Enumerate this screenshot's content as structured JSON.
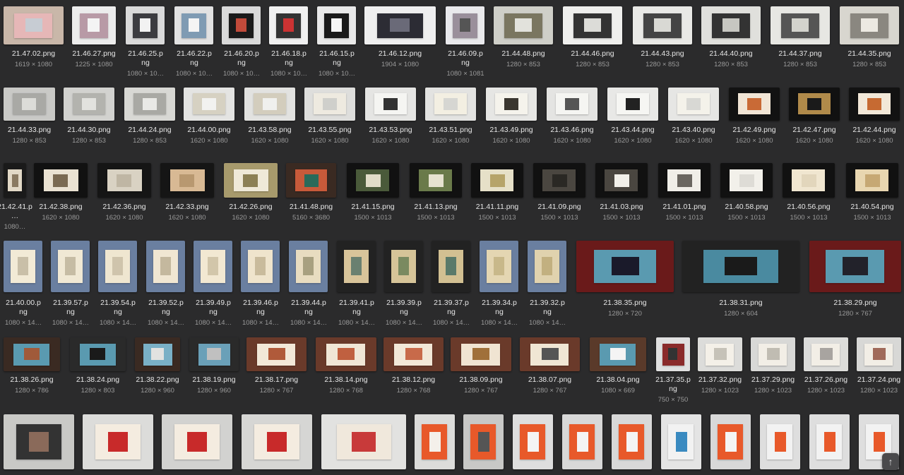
{
  "files": [
    {
      "name": "21.47.02.png",
      "dims": "1619 × 1080",
      "colors": [
        "#c9b7a9",
        "#e6b7b7",
        "#c7ccd3"
      ]
    },
    {
      "name": "21.46.27.png",
      "dims": "1225 × 1080",
      "colors": [
        "#ececec",
        "#b89aa6",
        "#f4f4f4"
      ]
    },
    {
      "name": "21.46.25.png",
      "dims": "1080 × 10…",
      "colors": [
        "#dadada",
        "#3c3c40",
        "#f2f2f2"
      ]
    },
    {
      "name": "21.46.22.png",
      "dims": "1080 × 10…",
      "colors": [
        "#e2e2e2",
        "#7f9bb3",
        "#f4f4f4"
      ]
    },
    {
      "name": "21.46.20.png",
      "dims": "1080 × 10…",
      "colors": [
        "#d9d9d9",
        "#1a1a1a",
        "#c14a3a"
      ]
    },
    {
      "name": "21.46.18.png",
      "dims": "1080 × 10…",
      "colors": [
        "#f0f0f0",
        "#333",
        "#c33"
      ]
    },
    {
      "name": "21.46.15.png",
      "dims": "1080 × 10…",
      "colors": [
        "#e9e9e9",
        "#1a1a1a",
        "#f5f5f5"
      ]
    },
    {
      "name": "21.46.12.png",
      "dims": "1904 × 1080",
      "colors": [
        "#efefef",
        "#2c2c34",
        "#6a6a78"
      ]
    },
    {
      "name": "21.46.09.png",
      "dims": "1080 × 1081",
      "colors": [
        "#e9e9ec",
        "#9a8f9b",
        "#555"
      ]
    },
    {
      "name": "21.44.48.png",
      "dims": "1280 × 853",
      "colors": [
        "#cfcfc8",
        "#7a7660",
        "#e2e2dc"
      ]
    },
    {
      "name": "21.44.46.png",
      "dims": "1280 × 853",
      "colors": [
        "#efefed",
        "#333",
        "#dcdcd8"
      ]
    },
    {
      "name": "21.44.43.png",
      "dims": "1280 × 853",
      "colors": [
        "#e9e9e6",
        "#444",
        "#d9d9d4"
      ]
    },
    {
      "name": "21.44.40.png",
      "dims": "1280 × 853",
      "colors": [
        "#e0e0dc",
        "#333",
        "#c7c7c1"
      ]
    },
    {
      "name": "21.44.37.png",
      "dims": "1280 × 853",
      "colors": [
        "#e7e7e3",
        "#555",
        "#d3d3cd"
      ]
    },
    {
      "name": "21.44.35.png",
      "dims": "1280 × 853",
      "colors": [
        "#d8d6cf",
        "#8a8780",
        "#ece9e2"
      ]
    },
    {
      "name": "21.44.33.png",
      "dims": "1280 × 853",
      "colors": [
        "#c9c9c6",
        "#a9a9a5",
        "#dcdcd8"
      ]
    },
    {
      "name": "21.44.30.png",
      "dims": "1280 × 853",
      "colors": [
        "#d2d2cf",
        "#b3b3ae",
        "#e2e2de"
      ]
    },
    {
      "name": "21.44.24.png",
      "dims": "1280 × 853",
      "colors": [
        "#d8d8d4",
        "#a9a9a4",
        "#e9e9e6"
      ]
    },
    {
      "name": "21.44.00.png",
      "dims": "1620 × 1080",
      "colors": [
        "#e4e4e2",
        "#d6d1c2",
        "#f2f2f0"
      ]
    },
    {
      "name": "21.43.58.png",
      "dims": "1620 × 1080",
      "colors": [
        "#e2e2e0",
        "#d3cdbd",
        "#f0f0ee"
      ]
    },
    {
      "name": "21.43.55.png",
      "dims": "1620 × 1080",
      "colors": [
        "#dededc",
        "#eeeae0",
        "#cfcfcb"
      ]
    },
    {
      "name": "21.43.53.png",
      "dims": "1620 × 1080",
      "colors": [
        "#e5e5e3",
        "#f5f5f2",
        "#333"
      ]
    },
    {
      "name": "21.43.51.png",
      "dims": "1620 × 1080",
      "colors": [
        "#e3e3e1",
        "#f3efe2",
        "#d6d6d2"
      ]
    },
    {
      "name": "21.43.49.png",
      "dims": "1620 × 1080",
      "colors": [
        "#e6e6e4",
        "#f5f3ec",
        "#3a3630"
      ]
    },
    {
      "name": "21.43.46.png",
      "dims": "1620 × 1080",
      "colors": [
        "#e4e4e2",
        "#f5f5f2",
        "#555"
      ]
    },
    {
      "name": "21.43.44.png",
      "dims": "1620 × 1080",
      "colors": [
        "#e8e8e6",
        "#f6f6f3",
        "#222"
      ]
    },
    {
      "name": "21.43.40.png",
      "dims": "1620 × 1080",
      "colors": [
        "#e6e6e4",
        "#f4f2ea",
        "#d8d8d4"
      ]
    },
    {
      "name": "21.42.49.png",
      "dims": "1620 × 1080",
      "colors": [
        "#121212",
        "#f1e5d5",
        "#c96a36"
      ]
    },
    {
      "name": "21.42.47.png",
      "dims": "1620 × 1080",
      "colors": [
        "#111",
        "#b08a4a",
        "#1a1a1a"
      ]
    },
    {
      "name": "21.42.44.png",
      "dims": "1620 × 1080",
      "colors": [
        "#121212",
        "#f2e8d8",
        "#c66a32"
      ]
    },
    {
      "name": "21.42.41.p…",
      "dims": "1080…",
      "colors": [
        "#1a1a1a",
        "#e2d9c7",
        "#8a7a62"
      ]
    },
    {
      "name": "21.42.38.png",
      "dims": "1620 × 1080",
      "colors": [
        "#111",
        "#eae2d2",
        "#7a6a52"
      ]
    },
    {
      "name": "21.42.36.png",
      "dims": "1620 × 1080",
      "colors": [
        "#151515",
        "#d9d2c3",
        "#bfb6a4"
      ]
    },
    {
      "name": "21.42.33.png",
      "dims": "1620 × 1080",
      "colors": [
        "#151515",
        "#d8b994",
        "#b89870"
      ]
    },
    {
      "name": "21.42.26.png",
      "dims": "1620 × 1080",
      "colors": [
        "#a79a6c",
        "#efe9d8",
        "#8c8055"
      ]
    },
    {
      "name": "21.41.48.png",
      "dims": "5160 × 3680",
      "colors": [
        "#3a2a22",
        "#c85a3a",
        "#2a6a5a"
      ]
    },
    {
      "name": "21.41.15.png",
      "dims": "1500 × 1013",
      "colors": [
        "#111",
        "#4a5a3a",
        "#e0dcc8"
      ]
    },
    {
      "name": "21.41.13.png",
      "dims": "1500 × 1013",
      "colors": [
        "#111",
        "#6a7a4a",
        "#e6e2d0"
      ]
    },
    {
      "name": "21.41.11.png",
      "dims": "1500 × 1013",
      "colors": [
        "#111",
        "#e6e0c8",
        "#b6a46a"
      ]
    },
    {
      "name": "21.41.09.png",
      "dims": "1500 × 1013",
      "colors": [
        "#111",
        "#4a4640",
        "#2a2824"
      ]
    },
    {
      "name": "21.41.03.png",
      "dims": "1500 × 1013",
      "colors": [
        "#111",
        "#4a4640",
        "#f2f0ea"
      ]
    },
    {
      "name": "21.41.01.png",
      "dims": "1500 × 1013",
      "colors": [
        "#111",
        "#f0eee8",
        "#6a6660"
      ]
    },
    {
      "name": "21.40.58.png",
      "dims": "1500 × 1013",
      "colors": [
        "#111",
        "#f2f0ea",
        "#dedcd6"
      ]
    },
    {
      "name": "21.40.56.png",
      "dims": "1500 × 1013",
      "colors": [
        "#111",
        "#f0e6d0",
        "#e2d6bc"
      ]
    },
    {
      "name": "21.40.54.png",
      "dims": "1500 × 1013",
      "colors": [
        "#111",
        "#e8d6b0",
        "#c6a874"
      ]
    },
    {
      "name": "21.40.00.png",
      "dims": "1080 × 14…",
      "colors": [
        "#6a7fa0",
        "#f2ead6",
        "#c9bfa8"
      ]
    },
    {
      "name": "21.39.57.png",
      "dims": "1080 × 14…",
      "colors": [
        "#6a7fa0",
        "#f0e8d4",
        "#c6bca4"
      ]
    },
    {
      "name": "21.39.54.png",
      "dims": "1080 × 14…",
      "colors": [
        "#6a7fa0",
        "#efe6d0",
        "#cfc4ac"
      ]
    },
    {
      "name": "21.39.52.png",
      "dims": "1080 × 14…",
      "colors": [
        "#6a7fa0",
        "#f0e6d2",
        "#c4b89e"
      ]
    },
    {
      "name": "21.39.49.png",
      "dims": "1080 × 14…",
      "colors": [
        "#6a7fa0",
        "#f2e8d2",
        "#d2c6aa"
      ]
    },
    {
      "name": "21.39.46.png",
      "dims": "1080 × 14…",
      "colors": [
        "#6a7fa0",
        "#efe4cc",
        "#c9bb9c"
      ]
    },
    {
      "name": "21.39.44.png",
      "dims": "1080 × 14…",
      "colors": [
        "#6a7fa0",
        "#e8dcc0",
        "#a8a080"
      ]
    },
    {
      "name": "21.39.41.png",
      "dims": "1080 × 14…",
      "colors": [
        "#222",
        "#d8c49a",
        "#6a8070"
      ]
    },
    {
      "name": "21.39.39.png",
      "dims": "1080 × 14…",
      "colors": [
        "#222",
        "#d6c498",
        "#7a8a60"
      ]
    },
    {
      "name": "21.39.37.png",
      "dims": "1080 × 14…",
      "colors": [
        "#222",
        "#d2c092",
        "#5a7a6a"
      ]
    },
    {
      "name": "21.39.34.png",
      "dims": "1080 × 14…",
      "colors": [
        "#6a7fa0",
        "#e4d6b2",
        "#c8b88a"
      ]
    },
    {
      "name": "21.39.32.png",
      "dims": "1080 × 14…",
      "colors": [
        "#6a7fa0",
        "#e0d2ae",
        "#c2b080"
      ]
    },
    {
      "name": "21.38.35.png",
      "dims": "1280 × 720",
      "colors": [
        "#6a1a1a",
        "#5a9ab0",
        "#1a1a2a"
      ]
    },
    {
      "name": "21.38.31.png",
      "dims": "1280 × 604",
      "colors": [
        "#222",
        "#4a8aa0",
        "#1a1a1a"
      ]
    },
    {
      "name": "21.38.29.png",
      "dims": "1280 × 767",
      "colors": [
        "#6a1a1a",
        "#5a9ab0",
        "#22222a"
      ]
    },
    {
      "name": "21.38.26.png",
      "dims": "1280 × 786",
      "colors": [
        "#3a2a22",
        "#5a9ab0",
        "#a05a3a"
      ]
    },
    {
      "name": "21.38.24.png",
      "dims": "1280 × 803",
      "colors": [
        "#2a2a2a",
        "#5a9ab0",
        "#1a1a1a"
      ]
    },
    {
      "name": "21.38.22.png",
      "dims": "1280 × 960",
      "colors": [
        "#3a2a22",
        "#7ab0c6",
        "#e2e2e0"
      ]
    },
    {
      "name": "21.38.19.png",
      "dims": "1280 × 960",
      "colors": [
        "#2a2a2a",
        "#6aa0b8",
        "#c0c0c0"
      ]
    },
    {
      "name": "21.38.17.png",
      "dims": "1280 × 767",
      "colors": [
        "#6a3a2a",
        "#f2e8d8",
        "#b05a3a"
      ]
    },
    {
      "name": "21.38.14.png",
      "dims": "1280 × 768",
      "colors": [
        "#6a3a2a",
        "#f0e6d6",
        "#c06040"
      ]
    },
    {
      "name": "21.38.12.png",
      "dims": "1280 × 768",
      "colors": [
        "#6a3a2a",
        "#f2e8d8",
        "#c86a4a"
      ]
    },
    {
      "name": "21.38.09.png",
      "dims": "1280 × 767",
      "colors": [
        "#6a3a2a",
        "#f0e4d2",
        "#a0703a"
      ]
    },
    {
      "name": "21.38.07.png",
      "dims": "1280 × 767",
      "colors": [
        "#6a3a2a",
        "#f0e6d4",
        "#555"
      ]
    },
    {
      "name": "21.38.04.png",
      "dims": "1080 × 669",
      "colors": [
        "#5a3a2a",
        "#5a9ab0",
        "#f4f4f4"
      ]
    },
    {
      "name": "21.37.35.png",
      "dims": "750 × 750",
      "colors": [
        "#e0e0e0",
        "#8a2a2a",
        "#333"
      ]
    },
    {
      "name": "21.37.32.png",
      "dims": "1280 × 1023",
      "colors": [
        "#dcdcda",
        "#f4f0e8",
        "#c6c2b8"
      ]
    },
    {
      "name": "21.37.29.png",
      "dims": "1280 × 1023",
      "colors": [
        "#d8d8d6",
        "#f2eee6",
        "#c0bcb2"
      ]
    },
    {
      "name": "21.37.26.png",
      "dims": "1280 × 1023",
      "colors": [
        "#dcdcda",
        "#f2eee6",
        "#a8a4a0"
      ]
    },
    {
      "name": "21.37.24.png",
      "dims": "1280 × 1023",
      "colors": [
        "#d8d8d6",
        "#f2eee6",
        "#a06a5a"
      ]
    },
    {
      "name": "",
      "dims": "",
      "colors": [
        "#c9c9c6",
        "#333",
        "#8a6a5a"
      ]
    },
    {
      "name": "",
      "dims": "",
      "colors": [
        "#dcdcda",
        "#f4ece0",
        "#c82a2a"
      ]
    },
    {
      "name": "",
      "dims": "",
      "colors": [
        "#d2d2d0",
        "#f4ece0",
        "#c82a2a"
      ]
    },
    {
      "name": "",
      "dims": "",
      "colors": [
        "#d6d6d4",
        "#f4ece0",
        "#c82a2a"
      ]
    },
    {
      "name": "",
      "dims": "",
      "colors": [
        "#e2e2e0",
        "#f0e8dc",
        "#c83a3a"
      ]
    },
    {
      "name": "",
      "dims": "",
      "colors": [
        "#dcdcda",
        "#e8592a",
        "#f4f0ea"
      ]
    },
    {
      "name": "",
      "dims": "",
      "colors": [
        "#c8c8c6",
        "#e8592a",
        "#555"
      ]
    },
    {
      "name": "",
      "dims": "",
      "colors": [
        "#dedede",
        "#e8592a",
        "#f4f4f4"
      ]
    },
    {
      "name": "",
      "dims": "",
      "colors": [
        "#d8d8d8",
        "#e8592a",
        "#f4f4f4"
      ]
    },
    {
      "name": "",
      "dims": "",
      "colors": [
        "#d8d8d8",
        "#e8592a",
        "#f4f4f4"
      ]
    },
    {
      "name": "",
      "dims": "",
      "colors": [
        "#e4e4e4",
        "#f2f2f2",
        "#3a8ac0"
      ]
    },
    {
      "name": "",
      "dims": "",
      "colors": [
        "#d8d8d8",
        "#e8592a",
        "#f4f4f4"
      ]
    },
    {
      "name": "",
      "dims": "",
      "colors": [
        "#dedede",
        "#f2f2f2",
        "#e8592a"
      ]
    },
    {
      "name": "",
      "dims": "",
      "colors": [
        "#dedede",
        "#f2f2f2",
        "#e8592a"
      ]
    },
    {
      "name": "",
      "dims": "",
      "colors": [
        "#dedede",
        "#f2f2f2",
        "#e8592a"
      ]
    }
  ],
  "scroll_top_icon": "arrow-up-icon",
  "scroll_top_glyph": "↑"
}
